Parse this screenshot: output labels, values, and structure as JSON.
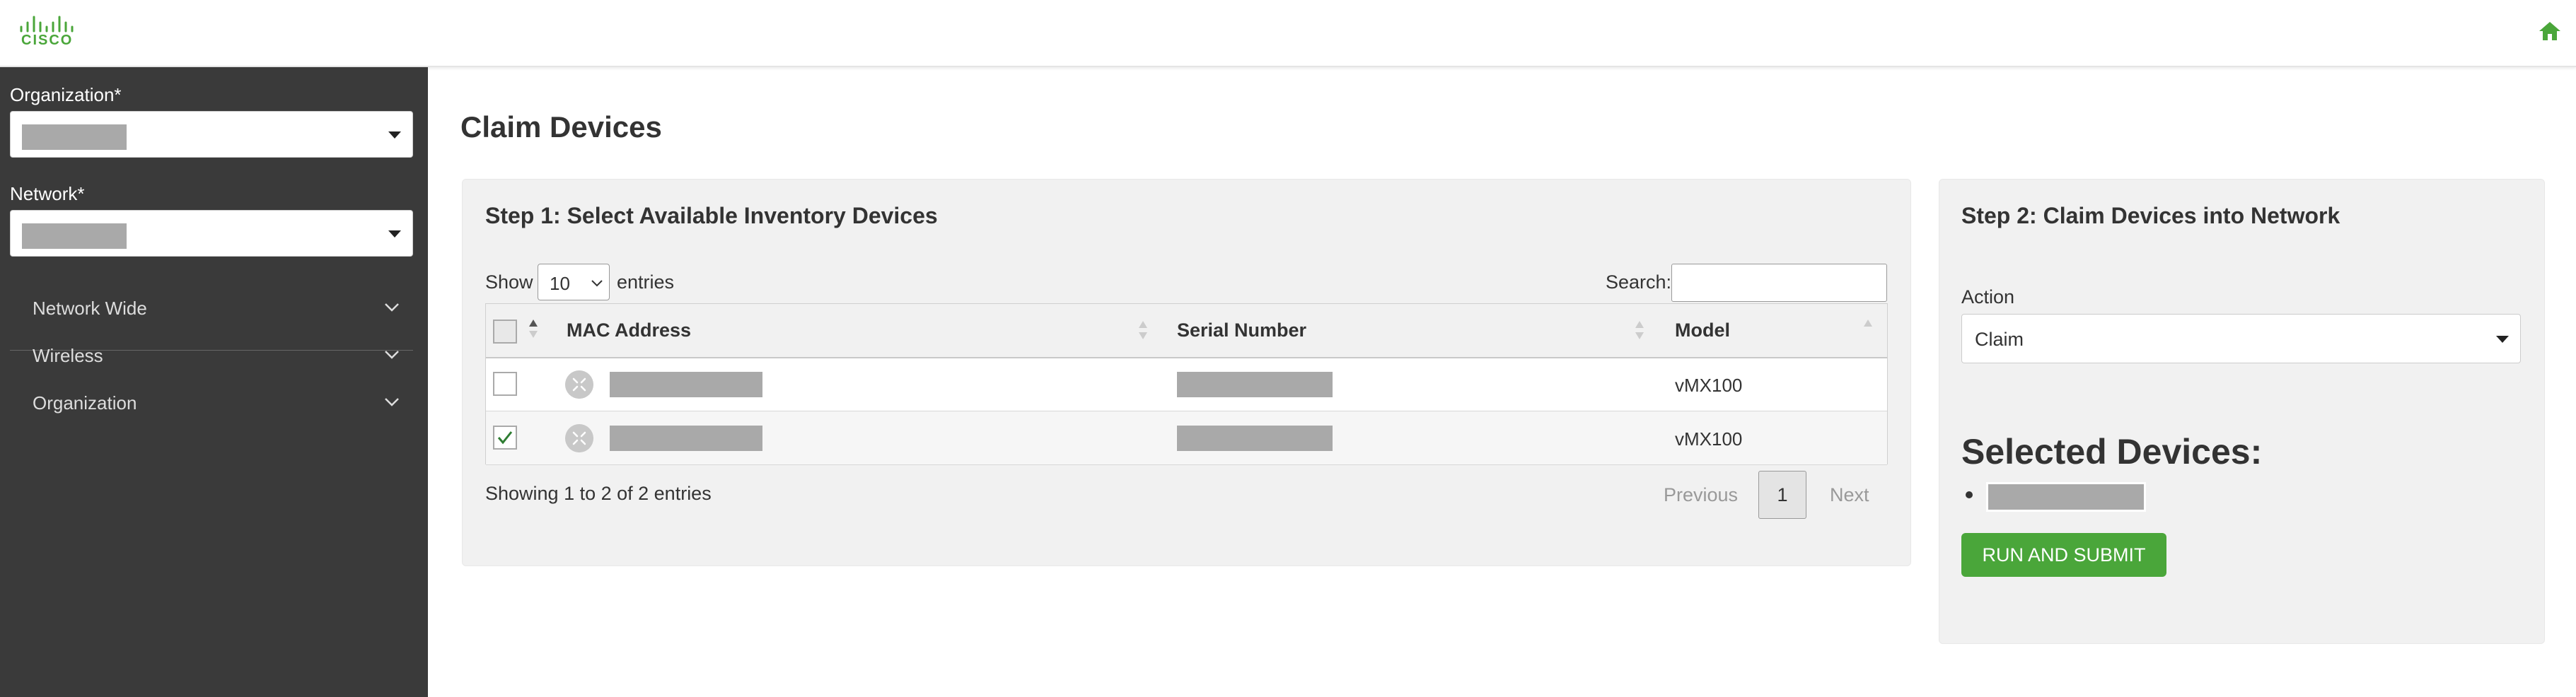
{
  "brand": {
    "logo_text": "CISCO",
    "accent_color": "#4aa63a"
  },
  "header": {
    "home_icon": "home-icon"
  },
  "sidebar": {
    "organization_label": "Organization*",
    "network_label": "Network*",
    "nav_items": [
      {
        "label": "Network Wide",
        "icon": "chevron-down-icon"
      },
      {
        "label": "Wireless",
        "icon": "chevron-down-icon"
      },
      {
        "label": "Organization",
        "icon": "chevron-down-icon"
      }
    ]
  },
  "page": {
    "title": "Claim Devices"
  },
  "step1": {
    "title": "Step 1: Select Available Inventory Devices",
    "show_label": "Show",
    "page_length": "10",
    "entries_label": "entries",
    "search_label": "Search:",
    "search_value": "",
    "columns": [
      "MAC Address",
      "Serial Number",
      "Model"
    ],
    "rows": [
      {
        "checked": false,
        "model": "vMX100"
      },
      {
        "checked": true,
        "model": "vMX100"
      }
    ],
    "info": "Showing 1 to 2 of 2 entries",
    "pager": {
      "previous": "Previous",
      "current": "1",
      "next": "Next"
    }
  },
  "step2": {
    "title": "Step 2: Claim Devices into Network",
    "action_label": "Action",
    "action_value": "Claim",
    "selected_title": "Selected Devices:",
    "submit_label": "RUN AND SUBMIT"
  }
}
